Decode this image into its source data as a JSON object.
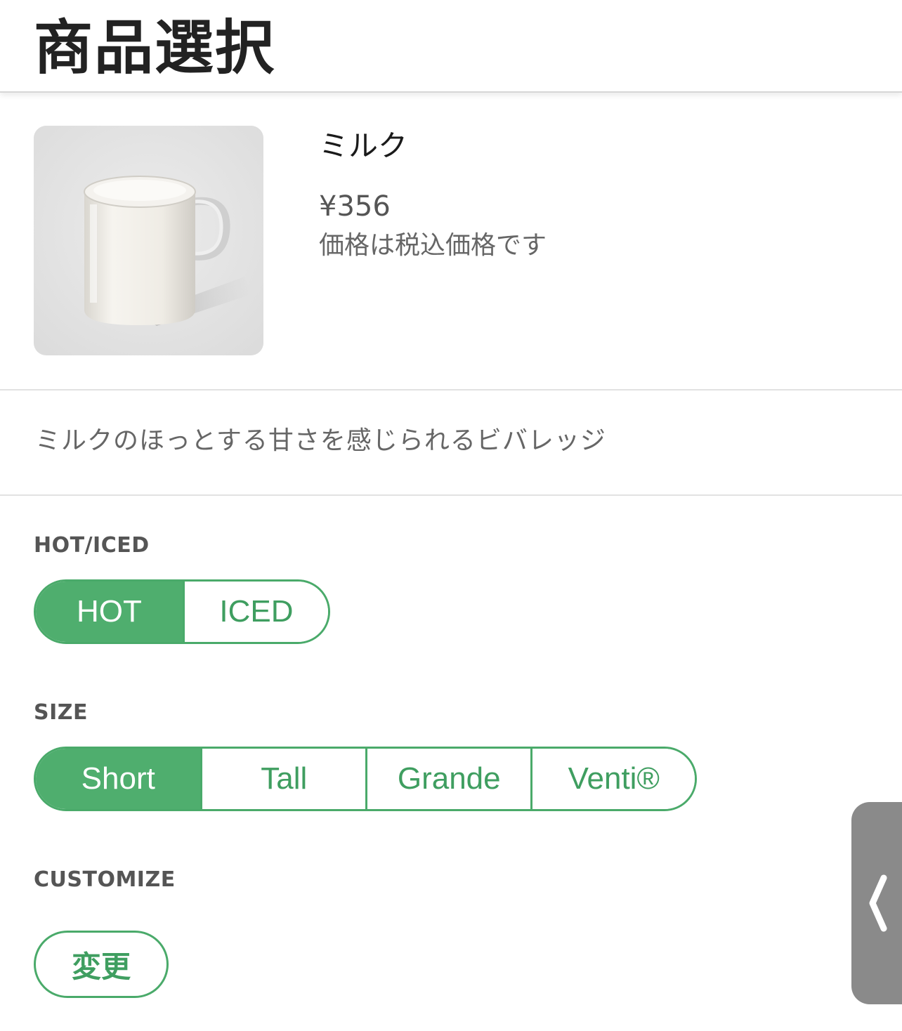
{
  "header": {
    "title": "商品選択"
  },
  "product": {
    "name": "ミルク",
    "price": "¥356",
    "tax_note": "価格は税込価格です",
    "image_icon": "milk-mug-image"
  },
  "description": "ミルクのほっとする甘さを感じられるビバレッジ",
  "temperature": {
    "label": "HOT/ICED",
    "options": [
      "HOT",
      "ICED"
    ],
    "selected": "HOT"
  },
  "size": {
    "label": "SIZE",
    "options": [
      "Short",
      "Tall",
      "Grande",
      "Venti®"
    ],
    "selected": "Short"
  },
  "customize": {
    "label": "CUSTOMIZE",
    "button_label": "変更"
  },
  "side_panel": {
    "icon": "chevron-left-icon"
  },
  "colors": {
    "accent_green": "#4fae6e",
    "text_dark": "#222222",
    "divider": "#e2e2e2",
    "side_tab": "#8a8a8a"
  }
}
